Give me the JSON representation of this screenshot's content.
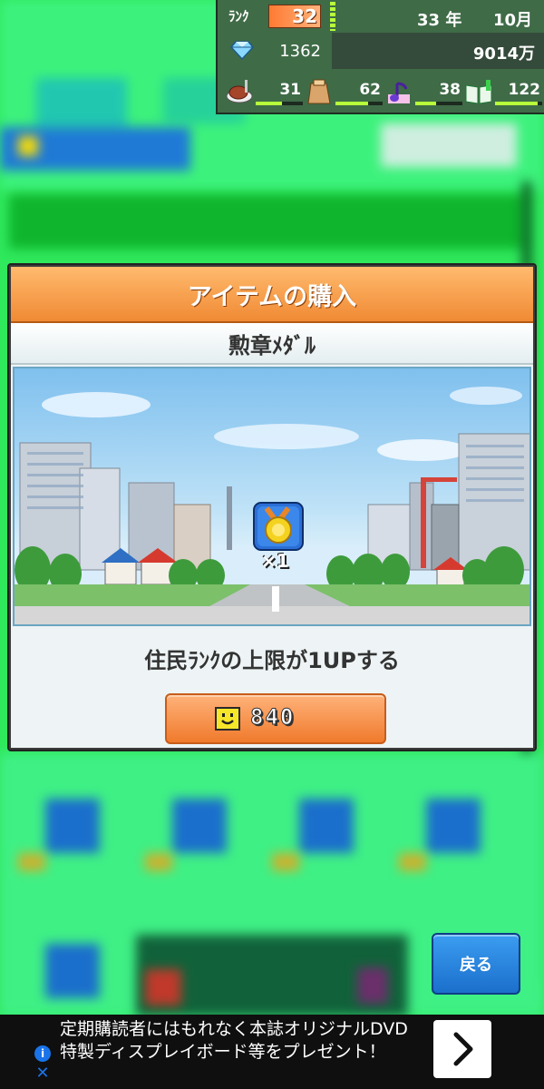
{
  "status": {
    "rank_label": "ﾗﾝｸ",
    "rank": "32",
    "year": "33 年",
    "month": "10月",
    "gems": "1362",
    "money": "9014万",
    "resources": [
      {
        "icon": "food-icon",
        "value": "31",
        "fill": 0.55
      },
      {
        "icon": "goods-icon",
        "value": "62",
        "fill": 0.7
      },
      {
        "icon": "music-icon",
        "value": "38",
        "fill": 0.45
      },
      {
        "icon": "book-icon",
        "value": "122",
        "fill": 0.9
      }
    ]
  },
  "modal": {
    "title": "アイテムの購入",
    "item_name": "勲章ﾒﾀﾞﾙ",
    "quantity": "×1",
    "description": "住民ﾗﾝｸの上限が1UPする",
    "price": "840"
  },
  "back_button": "戻る",
  "ad": {
    "text": "定期購読者にはもれなく本誌オリジナルDVD 特製ディスプレイボード等をプレゼント！",
    "info": "i",
    "close": "✕"
  },
  "colors": {
    "header_orange": "#f08a34",
    "button_orange": "#f07a2c",
    "back_blue": "#1b6fcc",
    "status_green": "#3f6b47"
  }
}
